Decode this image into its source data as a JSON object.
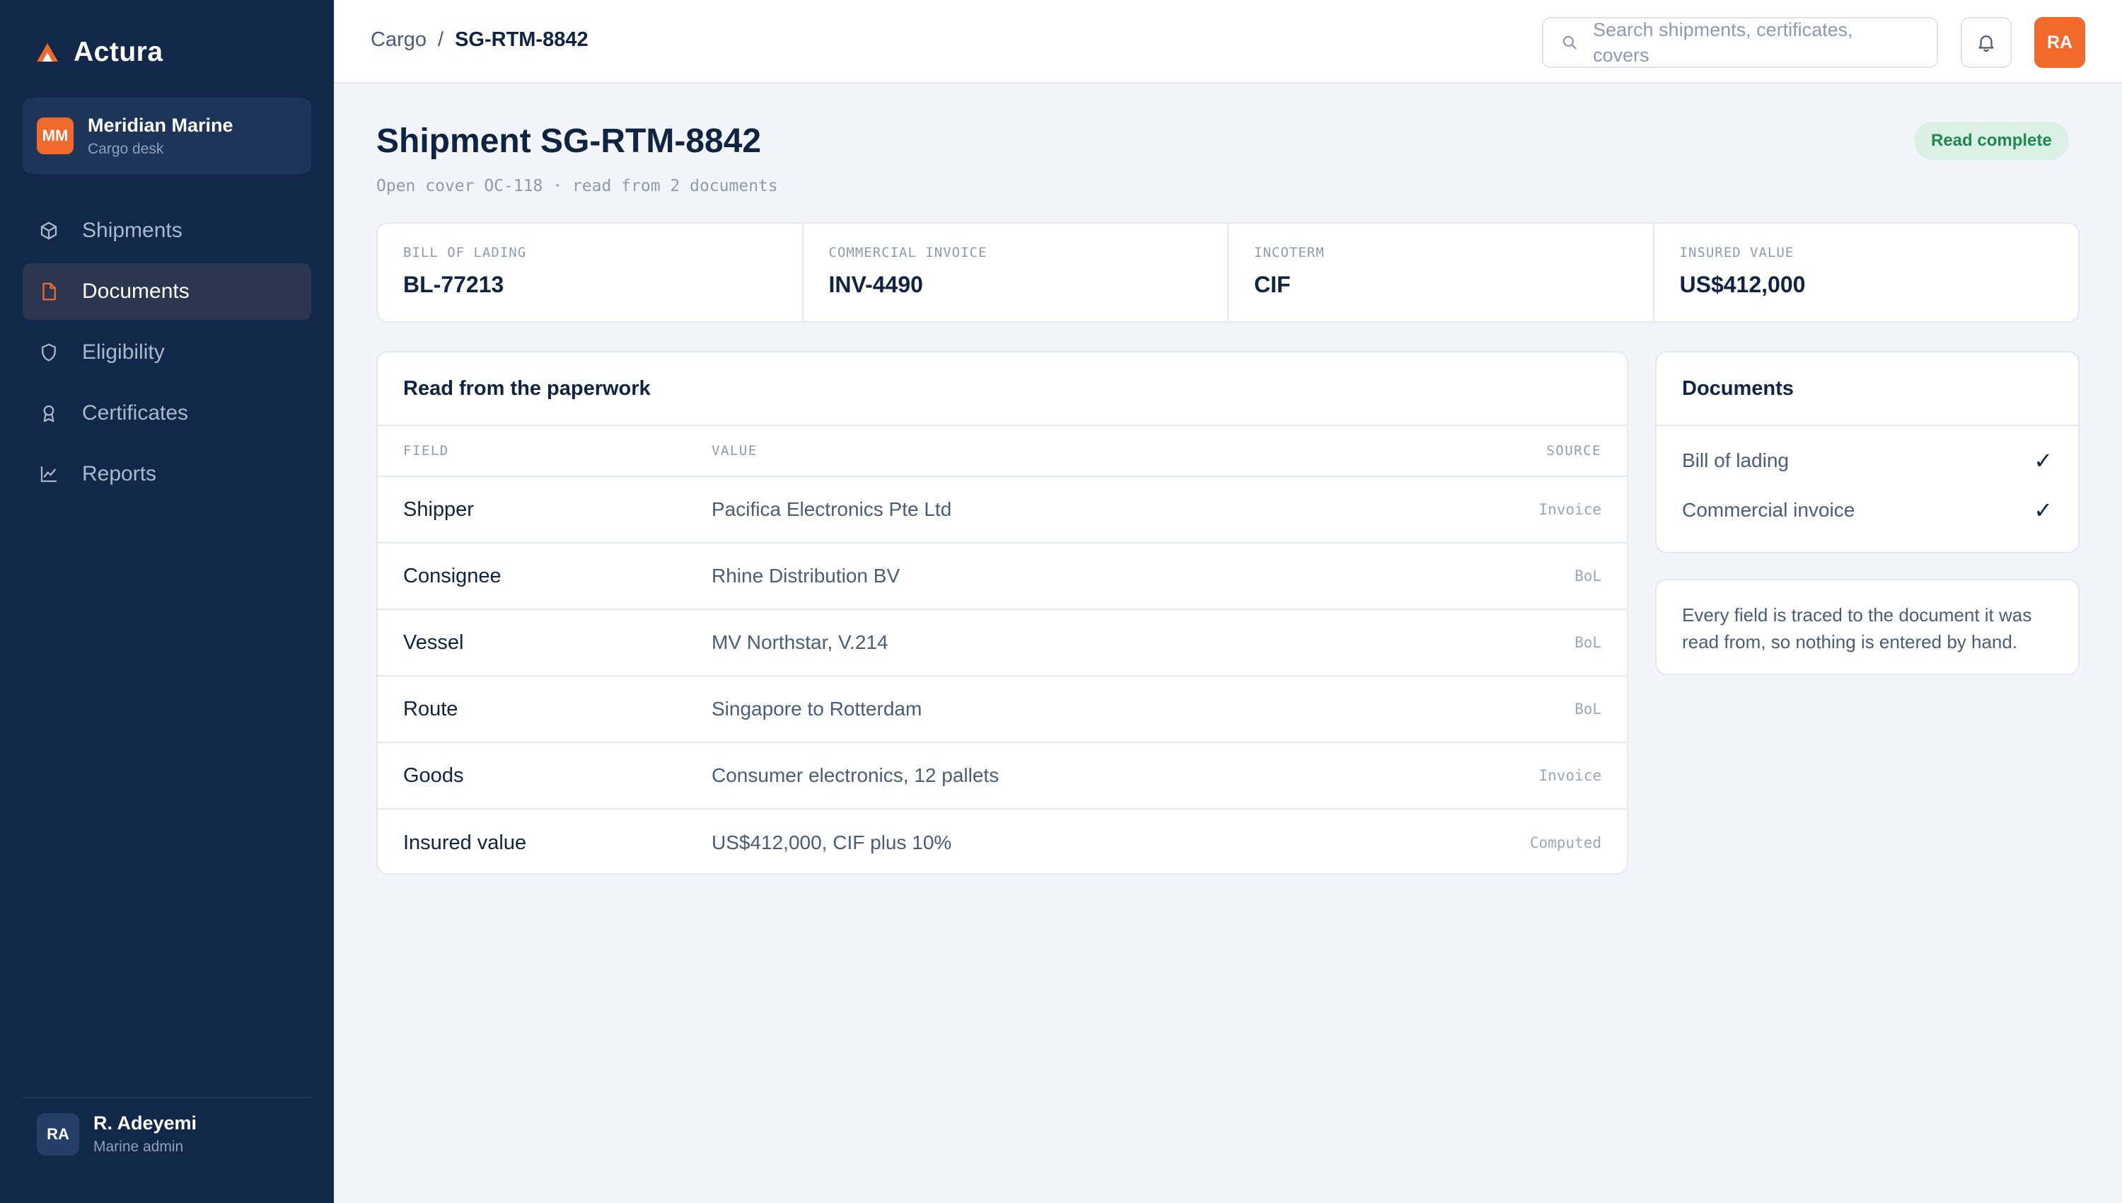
{
  "app": {
    "brand": "Actura",
    "accent_color": "#f26a2b",
    "sidebar_color": "#12284a"
  },
  "org": {
    "initials": "MM",
    "name": "Meridian Marine",
    "subtitle": "Cargo desk"
  },
  "nav": {
    "items": [
      {
        "label": "Shipments",
        "icon": "box-icon",
        "active": false
      },
      {
        "label": "Documents",
        "icon": "document-icon",
        "active": true
      },
      {
        "label": "Eligibility",
        "icon": "shield-icon",
        "active": false
      },
      {
        "label": "Certificates",
        "icon": "award-icon",
        "active": false
      },
      {
        "label": "Reports",
        "icon": "chart-icon",
        "active": false
      }
    ]
  },
  "user": {
    "initials": "RA",
    "name": "R. Adeyemi",
    "role": "Marine admin"
  },
  "topbar": {
    "breadcrumb_root": "Cargo",
    "breadcrumb_separator": "/",
    "breadcrumb_current": "SG-RTM-8842",
    "search_placeholder": "Search shipments, certificates, covers",
    "avatar_initials": "RA"
  },
  "page": {
    "title": "Shipment SG-RTM-8842",
    "subtitle": "Open cover OC-118 · read from 2 documents",
    "status": "Read complete",
    "status_color": "#1e8a4f"
  },
  "summary": [
    {
      "label": "BILL OF LADING",
      "value": "BL-77213"
    },
    {
      "label": "COMMERCIAL INVOICE",
      "value": "INV-4490"
    },
    {
      "label": "INCOTERM",
      "value": "CIF"
    },
    {
      "label": "INSURED VALUE",
      "value": "US$412,000"
    }
  ],
  "fields": {
    "title": "Read from the paperwork",
    "columns": {
      "field": "FIELD",
      "value": "VALUE",
      "source": "SOURCE"
    },
    "rows": [
      {
        "field": "Shipper",
        "value": "Pacifica Electronics Pte Ltd",
        "source": "Invoice"
      },
      {
        "field": "Consignee",
        "value": "Rhine Distribution BV",
        "source": "BoL"
      },
      {
        "field": "Vessel",
        "value": "MV Northstar, V.214",
        "source": "BoL"
      },
      {
        "field": "Route",
        "value": "Singapore to Rotterdam",
        "source": "BoL"
      },
      {
        "field": "Goods",
        "value": "Consumer electronics, 12 pallets",
        "source": "Invoice"
      },
      {
        "field": "Insured value",
        "value": "US$412,000, CIF plus 10%",
        "source": "Computed"
      }
    ]
  },
  "documents": {
    "title": "Documents",
    "items": [
      {
        "name": "Bill of lading",
        "check": "✓"
      },
      {
        "name": "Commercial invoice",
        "check": "✓"
      }
    ]
  },
  "note": {
    "text": "Every field is traced to the document it was read from, so nothing is entered by hand."
  }
}
